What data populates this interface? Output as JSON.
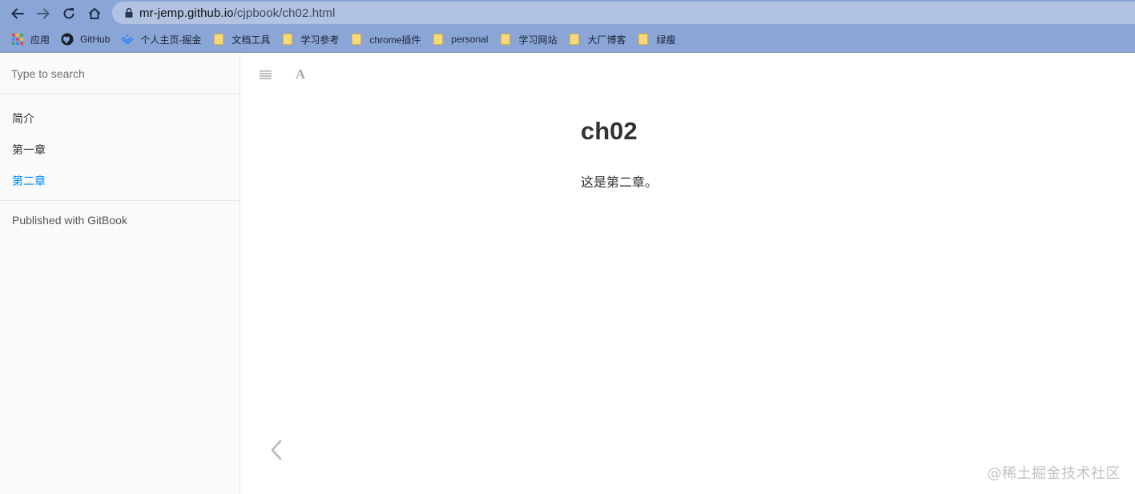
{
  "browser": {
    "url_host": "mr-jemp.github.io",
    "url_path": "/cjpbook/ch02.html",
    "bookmarks": [
      {
        "label": "应用",
        "icon": "apps-grid-icon"
      },
      {
        "label": "GitHub",
        "icon": "github-icon"
      },
      {
        "label": "个人主页-掘金",
        "icon": "juejin-icon"
      },
      {
        "label": "文档工具",
        "icon": "folder-icon"
      },
      {
        "label": "学习参考",
        "icon": "folder-icon"
      },
      {
        "label": "chrome插件",
        "icon": "folder-icon"
      },
      {
        "label": "personal",
        "icon": "folder-icon"
      },
      {
        "label": "学习网站",
        "icon": "folder-icon"
      },
      {
        "label": "大厂博客",
        "icon": "folder-icon"
      },
      {
        "label": "绿瘦",
        "icon": "folder-icon"
      }
    ]
  },
  "sidebar": {
    "search_placeholder": "Type to search",
    "items": [
      {
        "label": "简介",
        "active": false
      },
      {
        "label": "第一章",
        "active": false
      },
      {
        "label": "第二章",
        "active": true
      }
    ],
    "published": "Published with GitBook"
  },
  "header": {
    "font_button": "A"
  },
  "page": {
    "title": "ch02",
    "body": "这是第二章。"
  },
  "watermark": "@稀土掘金技术社区",
  "colors": {
    "chrome_bg": "#8aa5d6",
    "omnibox_bg": "#b2c3e2",
    "active_link": "#008cff",
    "sidebar_bg": "#fafafa"
  }
}
